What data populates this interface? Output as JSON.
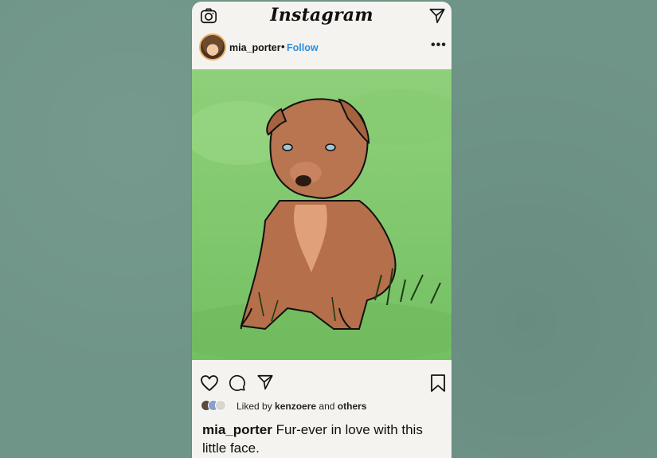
{
  "app": {
    "logo_text": "Instagram"
  },
  "post": {
    "username": "mia_porter",
    "separator": "•",
    "follow_label": "Follow",
    "more_label": "•••",
    "image": {
      "description_icon": "puppy-illustration"
    }
  },
  "likes": {
    "prefix": "Liked by",
    "user": "kenzoere",
    "middle": "and",
    "suffix": "others"
  },
  "caption": {
    "username": "mia_porter",
    "text": "Fur-ever in love with this little face."
  },
  "icons": {
    "camera": "camera-icon",
    "direct": "paper-plane-icon",
    "like": "heart-icon",
    "comment": "comment-icon",
    "share": "paper-plane-icon",
    "save": "bookmark-icon"
  },
  "colors": {
    "background": "#6f9488",
    "card": "#f4f3ef",
    "link": "#2a8fe0",
    "grass": "#7fc468",
    "puppy": "#b56f4a"
  }
}
